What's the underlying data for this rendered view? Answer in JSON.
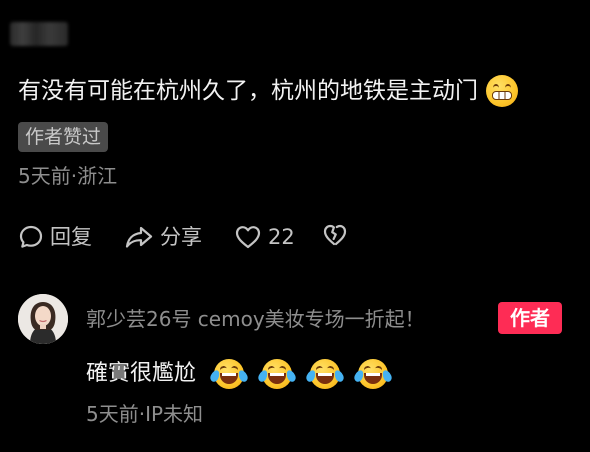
{
  "comment": {
    "text": "有没有可能在杭州久了，杭州的地铁是主动门",
    "emoji": "grinning-face-emoji",
    "badge": "作者赞过",
    "meta": "5天前·浙江"
  },
  "actions": {
    "reply_label": "回复",
    "share_label": "分享",
    "like_count": "22"
  },
  "reply": {
    "author_name": "郭少芸26号 cemoy美妆专场一折起！",
    "author_tag": "作者",
    "text": "確實很尷尬",
    "emojis": [
      "rolling-laughing-emoji",
      "rolling-laughing-emoji",
      "rolling-laughing-emoji",
      "rolling-laughing-emoji"
    ],
    "meta": "5天前·IP未知"
  },
  "colors": {
    "background": "#000000",
    "primary_text": "#f2f2f2",
    "secondary_text": "#8e8e8e",
    "author_tag": "#fe2c55",
    "badge_bg": "#4a4a4a"
  }
}
